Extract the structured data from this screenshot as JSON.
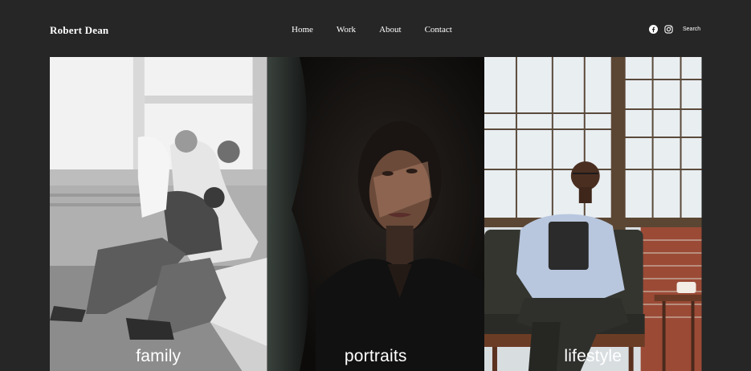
{
  "header": {
    "brand": "Robert Dean",
    "nav": [
      {
        "label": "Home"
      },
      {
        "label": "Work"
      },
      {
        "label": "About"
      },
      {
        "label": "Contact"
      }
    ],
    "social": [
      {
        "icon": "facebook-icon"
      },
      {
        "icon": "instagram-icon"
      }
    ],
    "search_label": "Search"
  },
  "gallery": {
    "tiles": [
      {
        "caption": "family"
      },
      {
        "caption": "portraits"
      },
      {
        "caption": "lifestyle"
      }
    ]
  },
  "colors": {
    "background": "#262626",
    "text": "#ffffff"
  }
}
